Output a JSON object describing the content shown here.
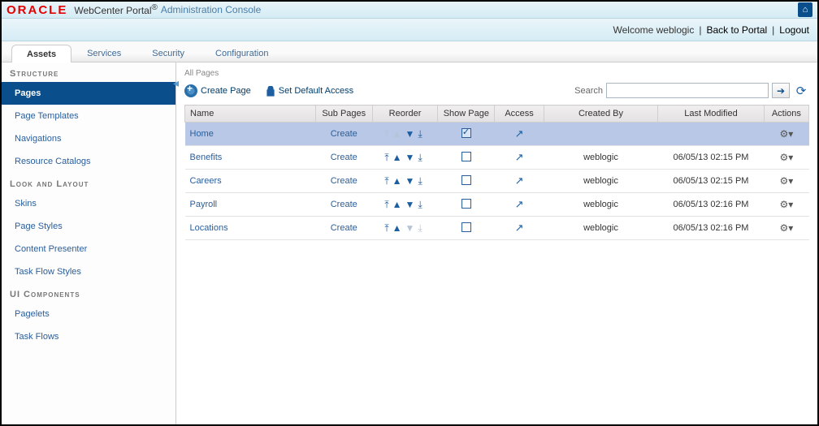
{
  "header": {
    "logo": "ORACLE",
    "product": "WebCenter Portal",
    "reg": "®",
    "subtitle": "Administration Console"
  },
  "welcome": {
    "text": "Welcome weblogic",
    "back": "Back to Portal",
    "logout": "Logout"
  },
  "tabs": [
    {
      "label": "Assets",
      "active": true
    },
    {
      "label": "Services",
      "active": false
    },
    {
      "label": "Security",
      "active": false
    },
    {
      "label": "Configuration",
      "active": false
    }
  ],
  "sidebar": {
    "groups": [
      {
        "title": "Structure",
        "items": [
          {
            "label": "Pages",
            "active": true
          },
          {
            "label": "Page Templates"
          },
          {
            "label": "Navigations"
          },
          {
            "label": "Resource Catalogs"
          }
        ]
      },
      {
        "title": "Look and Layout",
        "items": [
          {
            "label": "Skins"
          },
          {
            "label": "Page Styles"
          },
          {
            "label": "Content Presenter"
          },
          {
            "label": "Task Flow Styles"
          }
        ]
      },
      {
        "title": "UI Components",
        "items": [
          {
            "label": "Pagelets"
          },
          {
            "label": "Task Flows"
          }
        ]
      }
    ]
  },
  "content": {
    "breadcrumb": "All Pages",
    "create_page": "Create Page",
    "set_default": "Set Default Access",
    "search_label": "Search",
    "search_placeholder": ""
  },
  "columns": {
    "name": "Name",
    "sub": "Sub Pages",
    "reorder": "Reorder",
    "show": "Show Page",
    "access": "Access",
    "created": "Created By",
    "modified": "Last Modified",
    "actions": "Actions"
  },
  "rows": [
    {
      "name": "Home",
      "sub": "Create",
      "show": true,
      "selected": true,
      "top": true,
      "bottom": false,
      "created": "",
      "modified": ""
    },
    {
      "name": "Benefits",
      "sub": "Create",
      "show": false,
      "top": false,
      "bottom": false,
      "created": "weblogic",
      "modified": "06/05/13 02:15 PM"
    },
    {
      "name": "Careers",
      "sub": "Create",
      "show": false,
      "top": false,
      "bottom": false,
      "created": "weblogic",
      "modified": "06/05/13 02:15 PM"
    },
    {
      "name": "Payroll",
      "sub": "Create",
      "show": false,
      "top": false,
      "bottom": false,
      "created": "weblogic",
      "modified": "06/05/13 02:16 PM"
    },
    {
      "name": "Locations",
      "sub": "Create",
      "show": false,
      "top": false,
      "bottom": true,
      "created": "weblogic",
      "modified": "06/05/13 02:16 PM"
    }
  ]
}
